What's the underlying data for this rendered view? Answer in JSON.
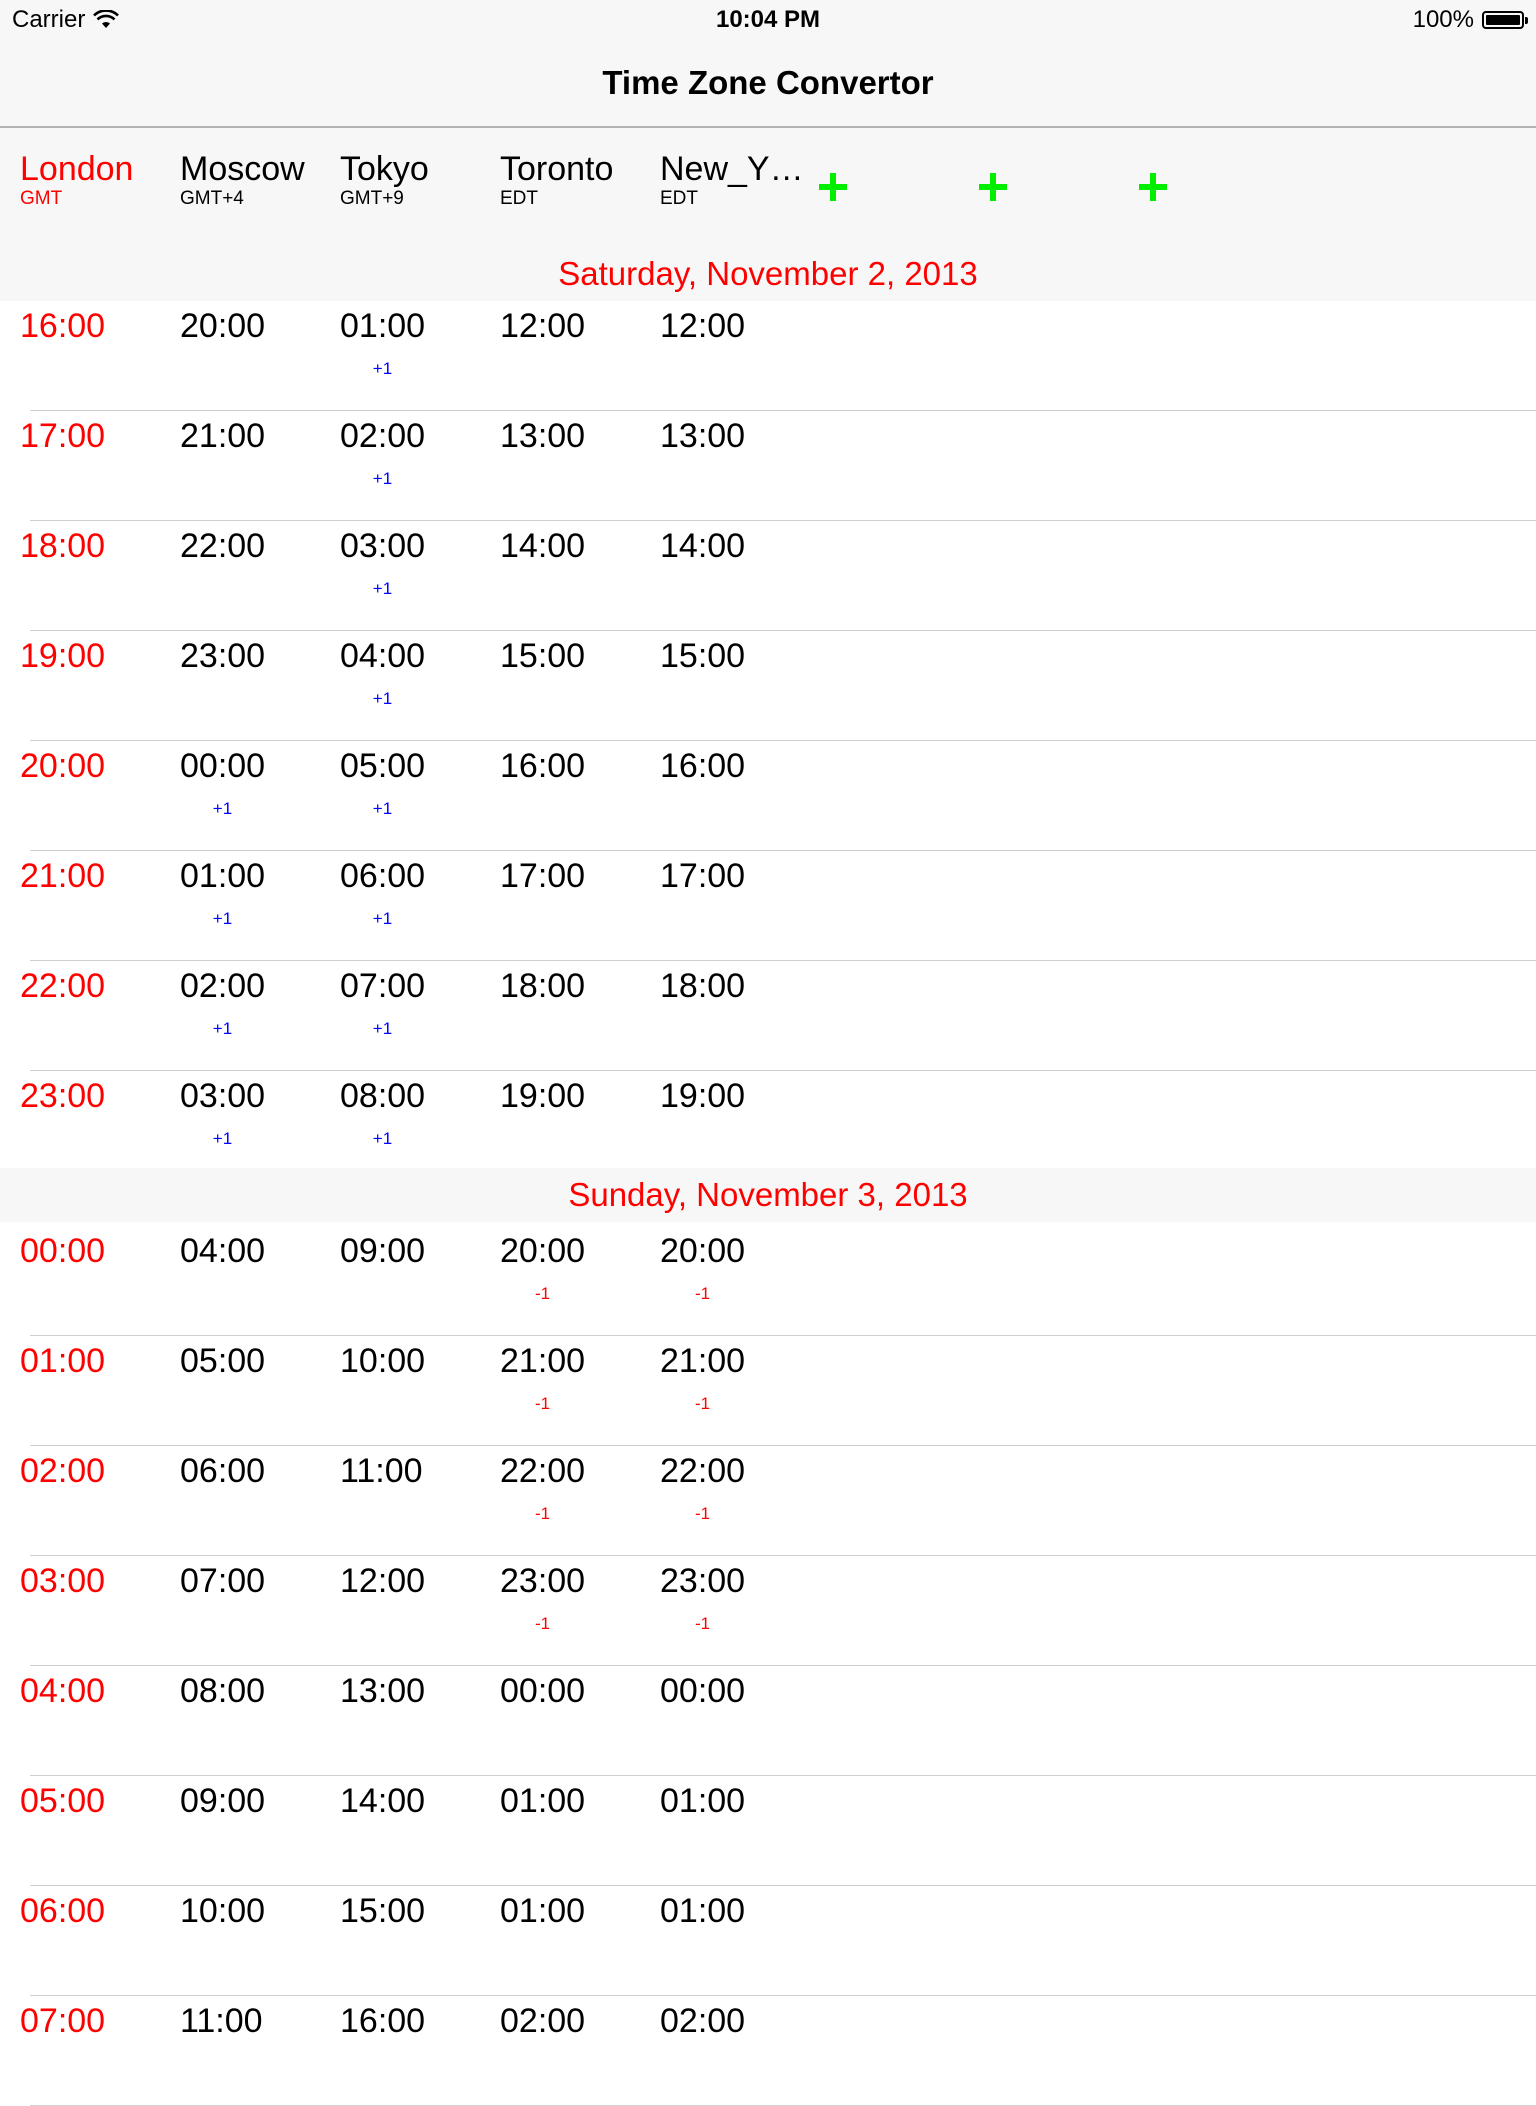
{
  "status_bar": {
    "carrier": "Carrier",
    "time": "10:04 PM",
    "battery": "100%"
  },
  "nav": {
    "title": "Time Zone Convertor"
  },
  "zones": [
    {
      "name": "London",
      "sub": "GMT",
      "home": true
    },
    {
      "name": "Moscow",
      "sub": "GMT+4"
    },
    {
      "name": "Tokyo",
      "sub": "GMT+9"
    },
    {
      "name": "Toronto",
      "sub": "EDT"
    },
    {
      "name": "New_Y…",
      "sub": "EDT"
    }
  ],
  "add_buttons": [
    "+",
    "+",
    "+"
  ],
  "colors": {
    "home": "#ff0000",
    "add": "#00ee00",
    "next_day": "#0000ff",
    "prev_day": "#ff0000"
  },
  "sections": [
    {
      "title": "Saturday, November 2, 2013",
      "rows": [
        {
          "times": [
            "16:00",
            "20:00",
            "01:00",
            "12:00",
            "12:00"
          ],
          "offsets": [
            "",
            "",
            "+1",
            "",
            ""
          ]
        },
        {
          "times": [
            "17:00",
            "21:00",
            "02:00",
            "13:00",
            "13:00"
          ],
          "offsets": [
            "",
            "",
            "+1",
            "",
            ""
          ]
        },
        {
          "times": [
            "18:00",
            "22:00",
            "03:00",
            "14:00",
            "14:00"
          ],
          "offsets": [
            "",
            "",
            "+1",
            "",
            ""
          ]
        },
        {
          "times": [
            "19:00",
            "23:00",
            "04:00",
            "15:00",
            "15:00"
          ],
          "offsets": [
            "",
            "",
            "+1",
            "",
            ""
          ]
        },
        {
          "times": [
            "20:00",
            "00:00",
            "05:00",
            "16:00",
            "16:00"
          ],
          "offsets": [
            "",
            "+1",
            "+1",
            "",
            ""
          ]
        },
        {
          "times": [
            "21:00",
            "01:00",
            "06:00",
            "17:00",
            "17:00"
          ],
          "offsets": [
            "",
            "+1",
            "+1",
            "",
            ""
          ]
        },
        {
          "times": [
            "22:00",
            "02:00",
            "07:00",
            "18:00",
            "18:00"
          ],
          "offsets": [
            "",
            "+1",
            "+1",
            "",
            ""
          ]
        },
        {
          "times": [
            "23:00",
            "03:00",
            "08:00",
            "19:00",
            "19:00"
          ],
          "offsets": [
            "",
            "+1",
            "+1",
            "",
            ""
          ]
        }
      ]
    },
    {
      "title": "Sunday, November 3, 2013",
      "rows": [
        {
          "times": [
            "00:00",
            "04:00",
            "09:00",
            "20:00",
            "20:00"
          ],
          "offsets": [
            "",
            "",
            "",
            "-1",
            "-1"
          ]
        },
        {
          "times": [
            "01:00",
            "05:00",
            "10:00",
            "21:00",
            "21:00"
          ],
          "offsets": [
            "",
            "",
            "",
            "-1",
            "-1"
          ]
        },
        {
          "times": [
            "02:00",
            "06:00",
            "11:00",
            "22:00",
            "22:00"
          ],
          "offsets": [
            "",
            "",
            "",
            "-1",
            "-1"
          ]
        },
        {
          "times": [
            "03:00",
            "07:00",
            "12:00",
            "23:00",
            "23:00"
          ],
          "offsets": [
            "",
            "",
            "",
            "-1",
            "-1"
          ]
        },
        {
          "times": [
            "04:00",
            "08:00",
            "13:00",
            "00:00",
            "00:00"
          ],
          "offsets": [
            "",
            "",
            "",
            "",
            ""
          ]
        },
        {
          "times": [
            "05:00",
            "09:00",
            "14:00",
            "01:00",
            "01:00"
          ],
          "offsets": [
            "",
            "",
            "",
            "",
            ""
          ]
        },
        {
          "times": [
            "06:00",
            "10:00",
            "15:00",
            "01:00",
            "01:00"
          ],
          "offsets": [
            "",
            "",
            "",
            "",
            ""
          ]
        },
        {
          "times": [
            "07:00",
            "11:00",
            "16:00",
            "02:00",
            "02:00"
          ],
          "offsets": [
            "",
            "",
            "",
            "",
            ""
          ]
        }
      ]
    }
  ]
}
